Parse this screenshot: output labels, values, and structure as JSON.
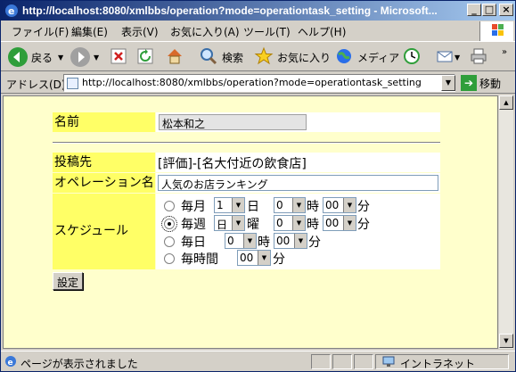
{
  "window": {
    "title": "http://localhost:8080/xmlbbs/operation?mode=operationtask_setting - Microsoft..."
  },
  "menu": [
    "ファイル(F)",
    "編集(E)",
    "表示(V)",
    "お気に入り(A)",
    "ツール(T)",
    "ヘルプ(H)"
  ],
  "toolbar": {
    "back": "戻る",
    "search": "検索",
    "favorites": "お気に入り",
    "media": "メディア"
  },
  "address": {
    "label": "アドレス(D)",
    "url": "http://localhost:8080/xmlbbs/operation?mode=operationtask_setting",
    "go": "移動"
  },
  "form": {
    "name_label": "名前",
    "name_value": "松本和之",
    "post_label": "投稿先",
    "post_value": "[評価]-[名大付近の飲食店]",
    "operation_label": "オペレーション名",
    "operation_value": "人気のお店ランキング",
    "schedule_label": "スケジュール",
    "schedule": {
      "monthly": {
        "label": "毎月",
        "day": "1",
        "day_unit": "日",
        "hour": "0",
        "hour_unit": "時",
        "minute": "00",
        "minute_unit": "分"
      },
      "weekly": {
        "label": "毎週",
        "weekday": "日",
        "weekday_unit": "曜",
        "hour": "0",
        "hour_unit": "時",
        "minute": "00",
        "minute_unit": "分"
      },
      "daily": {
        "label": "毎日",
        "hour": "0",
        "hour_unit": "時",
        "minute": "00",
        "minute_unit": "分"
      },
      "hourly": {
        "label": "毎時間",
        "minute": "00",
        "minute_unit": "分"
      },
      "selected": "weekly"
    },
    "submit": "設定"
  },
  "status": {
    "text": "ページが表示されました",
    "zone": "イントラネット"
  }
}
